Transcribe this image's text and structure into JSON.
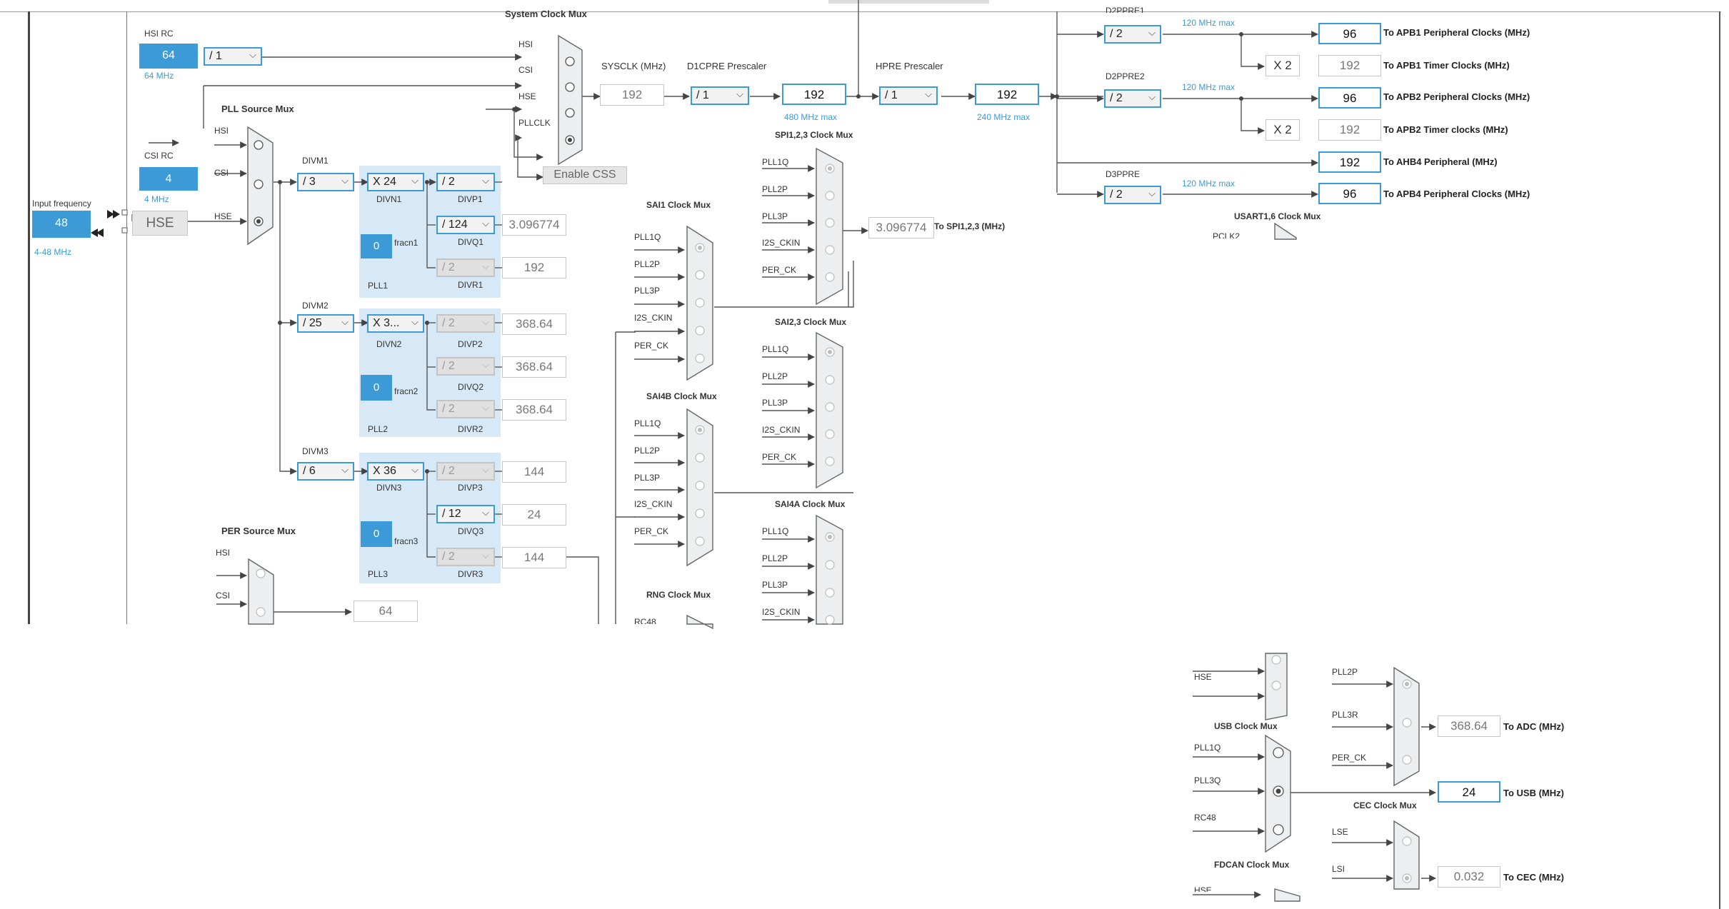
{
  "sysclk_mux": {
    "title": "System Clock Mux",
    "inputs": [
      "HSI",
      "CSI",
      "HSE",
      "PLLCLK"
    ],
    "enable_css": "Enable CSS"
  },
  "hsi": {
    "title": "HSI RC",
    "value": "64",
    "freq": "64 MHz",
    "div": "/ 1"
  },
  "csi": {
    "title": "CSI RC",
    "value": "4",
    "freq": "4 MHz"
  },
  "hse": {
    "label": "HSE",
    "input_title": "Input frequency",
    "input_value": "48",
    "input_range": "4-48 MHz"
  },
  "pll_source": {
    "title": "PLL Source Mux",
    "inputs": [
      "HSI",
      "CSI",
      "HSE"
    ]
  },
  "sysclk": {
    "label": "SYSCLK (MHz)",
    "value": "192"
  },
  "d1cpre": {
    "label": "D1CPRE Prescaler",
    "div": "/ 1",
    "out": "192",
    "max": "480 MHz max"
  },
  "hpre": {
    "label": "HPRE Prescaler",
    "div": "/ 1",
    "out": "192",
    "max": "240 MHz max"
  },
  "pll1": {
    "divm_label": "DIVM1",
    "divm": "/ 3",
    "divn": "X 24",
    "divn_label": "DIVN1",
    "divp": "/ 2",
    "divp_label": "DIVP1",
    "divq": "/ 124",
    "divq_label": "DIVQ1",
    "divq_out": "3.096774",
    "divr": "/ 2",
    "divr_label": "DIVR1",
    "divr_out": "192",
    "frac": "0",
    "frac_label": "fracn1",
    "name": "PLL1"
  },
  "pll2": {
    "divm_label": "DIVM2",
    "divm": "/ 25",
    "divn": "X 3...",
    "divn_label": "DIVN2",
    "divp": "/ 2",
    "divp_label": "DIVP2",
    "divp_out": "368.64",
    "divq": "/ 2",
    "divq_label": "DIVQ2",
    "divq_out": "368.64",
    "divr": "/ 2",
    "divr_label": "DIVR2",
    "divr_out": "368.64",
    "frac": "0",
    "frac_label": "fracn2",
    "name": "PLL2"
  },
  "pll3": {
    "divm_label": "DIVM3",
    "divm": "/ 6",
    "divn": "X 36",
    "divn_label": "DIVN3",
    "divp": "/ 2",
    "divp_label": "DIVP3",
    "divp_out": "144",
    "divq": "/ 12",
    "divq_label": "DIVQ3",
    "divq_out": "24",
    "divr": "/ 2",
    "divr_label": "DIVR3",
    "divr_out": "144",
    "frac": "0",
    "frac_label": "fracn3",
    "name": "PLL3"
  },
  "per_source": {
    "title": "PER Source Mux",
    "inputs": [
      "HSI",
      "CSI"
    ],
    "out": "64"
  },
  "sai1": {
    "title": "SAI1 Clock Mux",
    "inputs": [
      "PLL1Q",
      "PLL2P",
      "PLL3P",
      "I2S_CKIN",
      "PER_CK"
    ]
  },
  "sai4b": {
    "title": "SAI4B Clock Mux",
    "inputs": [
      "PLL1Q",
      "PLL2P",
      "PLL3P",
      "I2S_CKIN",
      "PER_CK"
    ]
  },
  "rng": {
    "title": "RNG Clock Mux",
    "inputs": [
      "RC48"
    ]
  },
  "spi123": {
    "title": "SPI1,2,3 Clock Mux",
    "inputs": [
      "PLL1Q",
      "PLL2P",
      "PLL3P",
      "I2S_CKIN",
      "PER_CK"
    ],
    "out": "3.096774",
    "out_label": "To SPI1,2,3 (MHz)"
  },
  "sai23": {
    "title": "SAI2,3 Clock Mux",
    "inputs": [
      "PLL1Q",
      "PLL2P",
      "PLL3P",
      "I2S_CKIN",
      "PER_CK"
    ]
  },
  "sai4a": {
    "title": "SAI4A Clock Mux",
    "inputs": [
      "PLL1Q",
      "PLL2P",
      "PLL3P",
      "I2S_CKIN"
    ]
  },
  "d2ppre1": {
    "label": "D2PPRE1",
    "div": "/ 2",
    "max": "120 MHz max",
    "periph": "96",
    "periph_label": "To APB1 Peripheral Clocks (MHz)",
    "mult": "X 2",
    "timer": "192",
    "timer_label": "To APB1 Timer Clocks (MHz)"
  },
  "d2ppre2": {
    "label": "D2PPRE2",
    "div": "/ 2",
    "max": "120 MHz max",
    "periph": "96",
    "periph_label": "To APB2 Peripheral Clocks (MHz)",
    "mult": "X 2",
    "timer": "192",
    "timer_label": "To APB2 Timer clocks (MHz)"
  },
  "ahb4": {
    "value": "192",
    "label": "To AHB4 Peripheral (MHz)"
  },
  "d3ppre": {
    "label": "D3PPRE",
    "div": "/ 2",
    "max": "120 MHz max",
    "value": "96",
    "out_label": "To APB4 Peripheral Clocks (MHz)"
  },
  "usart16": {
    "title": "USART1,6 Clock Mux",
    "input": "PCLK2"
  },
  "lower": {
    "top_inputs": [
      "HSE"
    ],
    "usb_title": "USB Clock Mux",
    "usb_inputs": [
      "PLL1Q",
      "PLL3Q",
      "RC48"
    ],
    "usb_out": "24",
    "usb_label": "To USB (MHz)",
    "adc_inputs": [
      "PLL2P",
      "PLL3R",
      "PER_CK"
    ],
    "adc_out": "368.64",
    "adc_label": "To ADC (MHz)",
    "cec_title": "CEC Clock Mux",
    "cec_inputs": [
      "LSE",
      "LSI"
    ],
    "cec_out": "0.032",
    "cec_label": "To CEC (MHz)",
    "fdcan_title": "FDCAN Clock Mux",
    "fdcan_input": "HSE"
  }
}
